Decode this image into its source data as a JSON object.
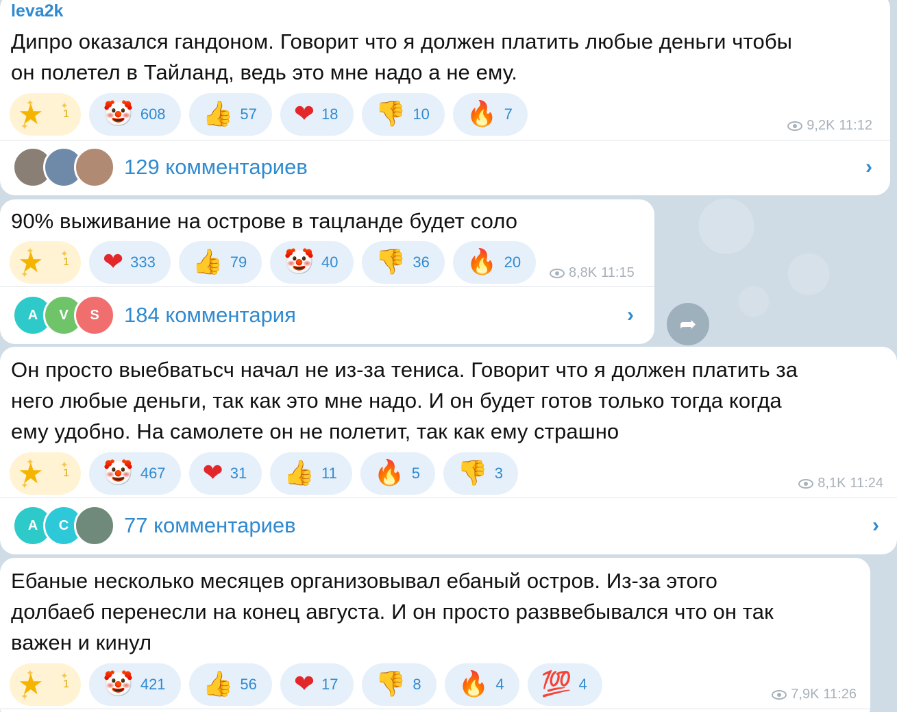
{
  "channel": {
    "sender": "leva2k"
  },
  "messages": [
    {
      "text_lines": [
        "Дипро оказался гандоном. Говорит что я должен платить любые деньги чтобы",
        "он полетел в Тайланд, ведь это мне надо а не ему."
      ],
      "star_count": "1",
      "reactions": [
        {
          "emoji": "🤡",
          "icon": "clown-icon",
          "count": "608"
        },
        {
          "emoji": "👍",
          "icon": "thumbs-up-icon",
          "count": "57"
        },
        {
          "emoji": "❤",
          "icon": "heart-icon",
          "count": "18"
        },
        {
          "emoji": "👎",
          "icon": "thumbs-down-icon",
          "count": "10"
        },
        {
          "emoji": "🔥",
          "icon": "fire-icon",
          "count": "7"
        }
      ],
      "views": "9,2K",
      "time": "11:12",
      "comments_label": "129 комментариев"
    },
    {
      "text_lines": [
        "90% выживание на острове в тацланде будет соло"
      ],
      "star_count": "1",
      "reactions": [
        {
          "emoji": "❤",
          "icon": "heart-icon",
          "count": "333"
        },
        {
          "emoji": "👍",
          "icon": "thumbs-up-icon",
          "count": "79"
        },
        {
          "emoji": "🤡",
          "icon": "clown-icon",
          "count": "40"
        },
        {
          "emoji": "👎",
          "icon": "thumbs-down-icon",
          "count": "36"
        },
        {
          "emoji": "🔥",
          "icon": "fire-icon",
          "count": "20"
        }
      ],
      "views": "8,8K",
      "time": "11:15",
      "comments_label": "184 комментария",
      "avatar_letters": [
        "A",
        "V",
        "S"
      ]
    },
    {
      "text_lines": [
        "Он просто выебватьсч начал не из-за тениса. Говорит что я должен платить за",
        "него любые деньги, так как это мне надо. И он будет готов только тогда когда",
        "ему удобно. На самолете он не полетит, так как ему страшно"
      ],
      "star_count": "1",
      "reactions": [
        {
          "emoji": "🤡",
          "icon": "clown-icon",
          "count": "467"
        },
        {
          "emoji": "❤",
          "icon": "heart-icon",
          "count": "31"
        },
        {
          "emoji": "👍",
          "icon": "thumbs-up-icon",
          "count": "11"
        },
        {
          "emoji": "🔥",
          "icon": "fire-icon",
          "count": "5"
        },
        {
          "emoji": "👎",
          "icon": "thumbs-down-icon",
          "count": "3"
        }
      ],
      "views": "8,1K",
      "time": "11:24",
      "comments_label": "77 комментариев",
      "avatar_letters": [
        "A",
        "C"
      ]
    },
    {
      "text_lines": [
        "Ебаные несколько месяцев организовывал ебаный остров. Из-за этого",
        "долбаеб перенесли на конец августа. И он просто разввебывался что он так",
        "важен и кинул"
      ],
      "star_count": "1",
      "reactions": [
        {
          "emoji": "🤡",
          "icon": "clown-icon",
          "count": "421"
        },
        {
          "emoji": "👍",
          "icon": "thumbs-up-icon",
          "count": "56"
        },
        {
          "emoji": "❤",
          "icon": "heart-icon",
          "count": "17"
        },
        {
          "emoji": "👎",
          "icon": "thumbs-down-icon",
          "count": "8"
        },
        {
          "emoji": "🔥",
          "icon": "fire-icon",
          "count": "4"
        },
        {
          "emoji": "💯",
          "icon": "hundred-points-icon",
          "count": "4"
        }
      ],
      "views": "7,9K",
      "time": "11:26"
    }
  ],
  "colors": {
    "accent": "#2f8ad0",
    "chip_bg": "#e6f0fa",
    "star_chip_bg": "#fff3d4",
    "meta": "#a7b1ba",
    "heart": "#e3262a",
    "fire": "#f4511e",
    "thumb": "#f7b928"
  }
}
